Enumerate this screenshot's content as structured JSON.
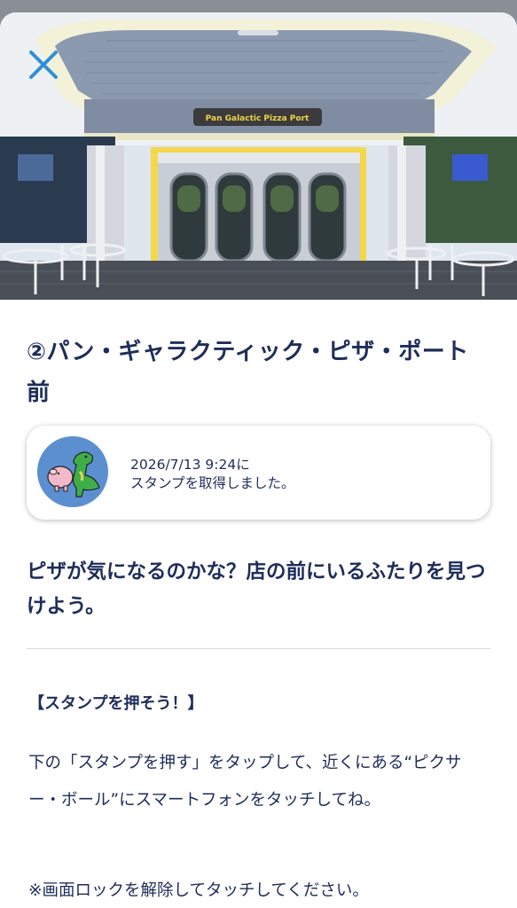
{
  "header": {
    "hero_image": "Pan Galactic Pizza Port storefront photo",
    "sign_text": "Pan Galactic Pizza Port",
    "close_icon": "close-x-icon"
  },
  "spot": {
    "title": "②パン・ギャラクティック・ピザ・ポート前"
  },
  "stamp_card": {
    "avatar_icon": "character-stamp-icon",
    "datetime": "2026/7/13 9:24に",
    "status": "スタンプを取得しました。"
  },
  "hint": {
    "text": "ピザが気になるのかな？店の前にいるふたりを見つけよう。"
  },
  "instructions": {
    "heading": "【スタンプを押そう！】",
    "body": "下の「スタンプを押す」をタップして、近くにある“ピクサー・ボール”にスマートフォンをタッチしてね。",
    "note": "※画面ロックを解除してタッチしてください。"
  },
  "colors": {
    "text": "#1e2d5a",
    "close_icon": "#2f8fd6",
    "avatar_bg": "#5b8fd0",
    "backdrop": "#8a8f96"
  }
}
